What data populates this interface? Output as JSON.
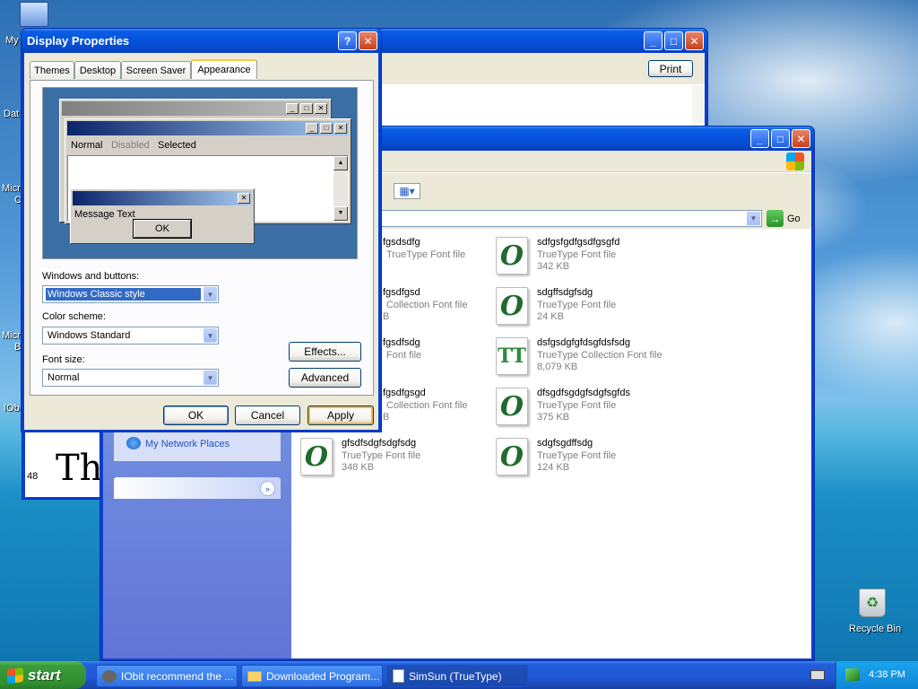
{
  "desktop": {
    "left_labels": [
      "My",
      "Dat",
      "Micro",
      "C",
      "Micro",
      "B",
      "IOb"
    ],
    "recycle_bin": "Recycle Bin"
  },
  "back_window": {
    "print_label": "Print",
    "size_label": "48",
    "sample_text": "Th"
  },
  "explorer": {
    "go_label": "Go",
    "sidebar_link": "My Network Places",
    "files": [
      {
        "name": "fgsdsdfg",
        "type": "TrueType Font file",
        "size": "",
        "icon": "O"
      },
      {
        "name": "sdfgsfgdfgsdfgsgfd",
        "type": "TrueType Font file",
        "size": "342 KB",
        "icon": "O"
      },
      {
        "name": "fgsdfgsd",
        "type": "Collection Font file",
        "size": "B",
        "icon": "O"
      },
      {
        "name": "sdgffsdgfsdg",
        "type": "TrueType Font file",
        "size": "24 KB",
        "icon": "O"
      },
      {
        "name": "fgsdfsdg",
        "type": "Font file",
        "size": "",
        "icon": "O"
      },
      {
        "name": "dsfgsdgfgfdsgfdsfsdg",
        "type": "TrueType Collection Font file",
        "size": "8,079 KB",
        "icon": "TT"
      },
      {
        "name": "fgsdfgsgd",
        "type": "Collection Font file",
        "size": "B",
        "icon": "O"
      },
      {
        "name": "dfsgdfsgdgfsdgfsgfds",
        "type": "TrueType Font file",
        "size": "375 KB",
        "icon": "O"
      },
      {
        "name": "gfsdfsdgfsdgfsdg",
        "type": "TrueType Font file",
        "size": "348 KB",
        "icon": "O"
      },
      {
        "name": "sdgfsgdffsdg",
        "type": "TrueType Font file",
        "size": "124 KB",
        "icon": "O"
      }
    ]
  },
  "display_properties": {
    "title": "Display Properties",
    "tabs": [
      "Themes",
      "Desktop",
      "Screen Saver",
      "Appearance"
    ],
    "active_tab": "Appearance",
    "preview": {
      "menu_normal": "Normal",
      "menu_disabled": "Disabled",
      "menu_selected": "Selected",
      "message_text": "Message Text",
      "ok_label": "OK"
    },
    "windows_buttons_label": "Windows and buttons:",
    "windows_buttons_value": "Windows Classic style",
    "color_scheme_label": "Color scheme:",
    "color_scheme_value": "Windows Standard",
    "font_size_label": "Font size:",
    "font_size_value": "Normal",
    "effects_label": "Effects...",
    "advanced_label": "Advanced",
    "ok_label": "OK",
    "cancel_label": "Cancel",
    "apply_label": "Apply"
  },
  "taskbar": {
    "start_label": "start",
    "tasks": [
      "IObit recommend the ...",
      "Downloaded Program...",
      "SimSun (TrueType)"
    ],
    "clock": "4:38 PM"
  },
  "colors": {
    "xp_blue": "#0a3fd2",
    "sidebar_blue": "#6a7de0",
    "preview_blue": "#3a6ea5",
    "start_green": "#3c9c3c"
  }
}
